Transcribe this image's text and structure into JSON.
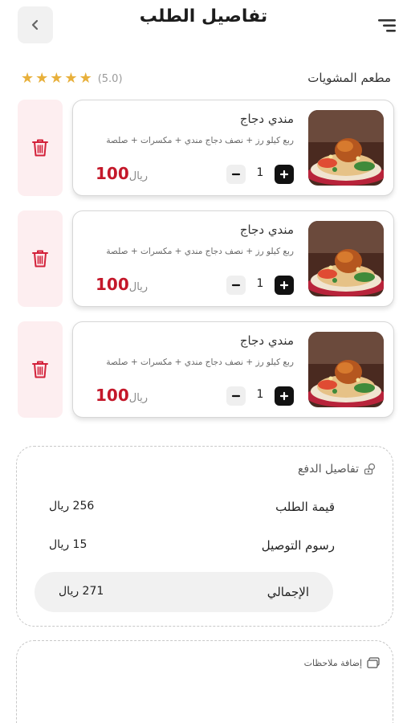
{
  "header": {
    "title": "تفاصيل الطلب",
    "back_icon": "chevron-left-icon",
    "menu_icon": "menu-icon"
  },
  "restaurant": {
    "name": "مطعم المشويات",
    "rating_text": "(5.0)",
    "stars": 5
  },
  "items": [
    {
      "name": "مندي دجاج",
      "description": "ربع كيلو رز + نصف دجاج مندي + مكسرات + صلصة",
      "quantity": "1",
      "price": "100",
      "currency": "ريال"
    },
    {
      "name": "مندي دجاج",
      "description": "ربع كيلو رز + نصف دجاج مندي + مكسرات + صلصة",
      "quantity": "1",
      "price": "100",
      "currency": "ريال"
    },
    {
      "name": "مندي دجاج",
      "description": "ربع كيلو رز + نصف دجاج مندي + مكسرات + صلصة",
      "quantity": "1",
      "price": "100",
      "currency": "ريال"
    }
  ],
  "payment": {
    "title": "تفاصيل الدفع",
    "order_value_label": "قيمة الطلب",
    "order_value": "256 ريال",
    "delivery_label": "رسوم التوصيل",
    "delivery_value": "15 ريال",
    "total_label": "الإجمالي",
    "total_value": "271 ريال"
  },
  "notes": {
    "title": "إضافة ملاحظات"
  },
  "colors": {
    "accent": "#c4182a",
    "star": "#e8b03b",
    "delete_bg": "#fdeef0"
  }
}
